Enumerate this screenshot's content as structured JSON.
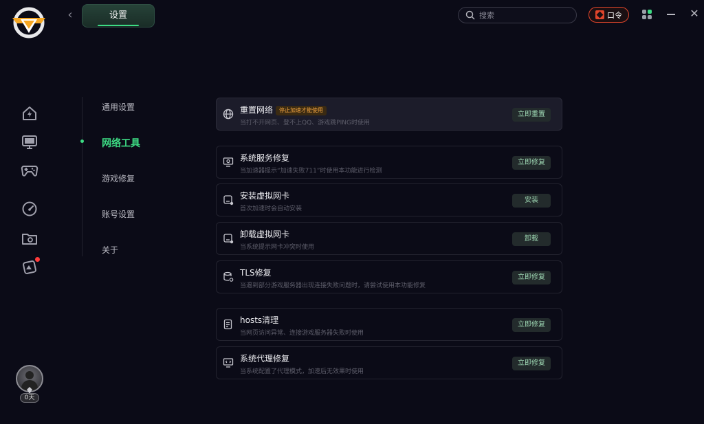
{
  "header": {
    "title": "设置",
    "search_placeholder": "搜索",
    "code_label": "口令"
  },
  "colors": {
    "accent": "#3ddc84",
    "warning_tag": "#f0a340",
    "code_border": "#e0452b"
  },
  "leftnav": {
    "icons": [
      "home-bolt-icon",
      "monitor-icon",
      "gamepad-icon",
      "speedometer-icon",
      "folder-video-icon",
      "game-card-icon"
    ]
  },
  "user": {
    "days": "0天"
  },
  "settings_menu": {
    "items": [
      {
        "label": "通用设置",
        "active": false
      },
      {
        "label": "网络工具",
        "active": true
      },
      {
        "label": "游戏修复",
        "active": false
      },
      {
        "label": "账号设置",
        "active": false
      },
      {
        "label": "关于",
        "active": false
      }
    ]
  },
  "tools": [
    {
      "title": "重置网络",
      "tag": "停止加速才能使用",
      "desc": "当打不开网页、登不上QQ、游戏跳PING时使用",
      "button": "立即重置",
      "icon": "globe-icon"
    },
    {
      "title": "系统服务修复",
      "desc": "当加速器提示“加速失败711”时使用本功能进行检测",
      "button": "立即修复",
      "icon": "monitor-gear-icon"
    },
    {
      "title": "安装虚拟网卡",
      "desc": "首次加速时会自动安装",
      "button": "安装",
      "icon": "network-card-icon"
    },
    {
      "title": "卸载虚拟网卡",
      "desc": "当系统提示网卡冲突时使用",
      "button": "卸载",
      "icon": "network-card-remove-icon"
    },
    {
      "title": "TLS修复",
      "desc": "当遇到部分游戏服务器出现连接失败问题时，请尝试使用本功能修复",
      "button": "立即修复",
      "icon": "database-gear-icon"
    },
    {
      "title": "hosts清理",
      "desc": "当网页访问异常、连接游戏服务器失败时使用",
      "button": "立即修复",
      "icon": "file-list-icon"
    },
    {
      "title": "系统代理修复",
      "desc": "当系统配置了代理模式，加速后无效果时使用",
      "button": "立即修复",
      "icon": "monitor-code-icon"
    }
  ]
}
